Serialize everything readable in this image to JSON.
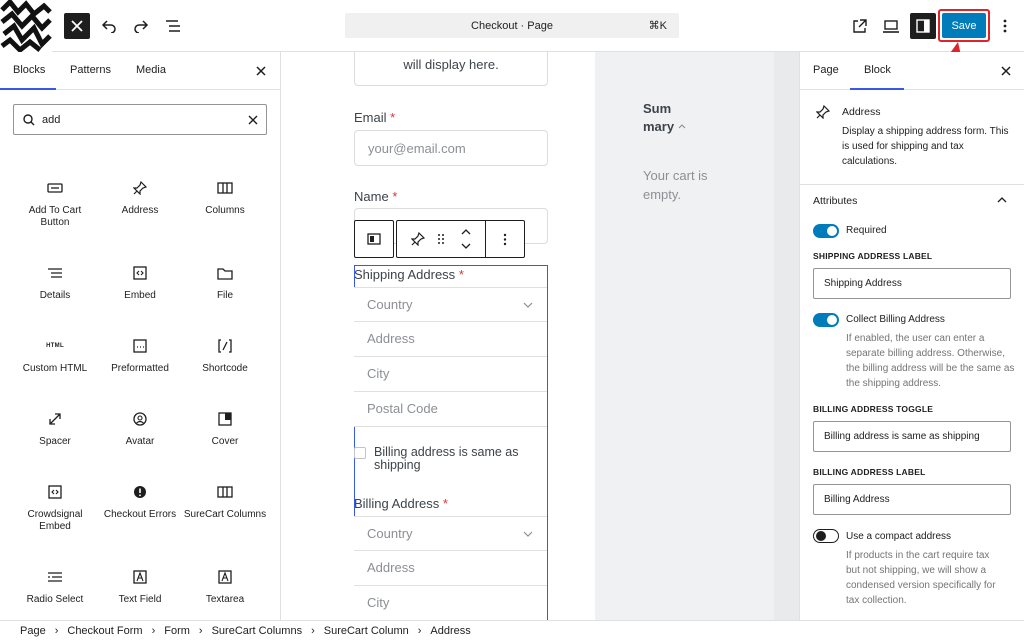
{
  "topbar": {
    "command_center": "Checkout · Page",
    "shortcut": "⌘K",
    "save_label": "Save",
    "icons": [
      "close-icon",
      "undo-icon",
      "redo-icon",
      "document-overview-icon",
      "external-view-icon",
      "device-preview-icon",
      "settings-panel-icon",
      "more-options-icon"
    ]
  },
  "inserter": {
    "tabs": [
      "Blocks",
      "Patterns",
      "Media"
    ],
    "search_value": "add",
    "blocks": [
      {
        "label": "Add To Cart Button",
        "icon": "button-icon"
      },
      {
        "label": "Address",
        "icon": "pin-icon"
      },
      {
        "label": "Columns",
        "icon": "columns-icon"
      },
      {
        "label": "Details",
        "icon": "details-icon"
      },
      {
        "label": "Embed",
        "icon": "embed-icon"
      },
      {
        "label": "File",
        "icon": "folder-icon"
      },
      {
        "label": "Custom HTML",
        "icon": "html-icon"
      },
      {
        "label": "Preformatted",
        "icon": "preformatted-icon"
      },
      {
        "label": "Shortcode",
        "icon": "shortcode-icon"
      },
      {
        "label": "Spacer",
        "icon": "spacer-icon"
      },
      {
        "label": "Avatar",
        "icon": "avatar-icon"
      },
      {
        "label": "Cover",
        "icon": "cover-icon"
      },
      {
        "label": "Crowdsignal Embed",
        "icon": "embed-icon"
      },
      {
        "label": "Checkout Errors",
        "icon": "error-icon"
      },
      {
        "label": "SureCart Columns",
        "icon": "columns-icon"
      },
      {
        "label": "Radio Select",
        "icon": "radio-select-icon"
      },
      {
        "label": "Text Field",
        "icon": "text-field-icon"
      },
      {
        "label": "Textarea",
        "icon": "textarea-icon"
      }
    ]
  },
  "canvas": {
    "placeholder_tail": "will display here.",
    "email_label": "Email",
    "email_placeholder": "your@email.com",
    "name_label": "Name",
    "shipping_label": "Shipping Address",
    "country": "Country",
    "address": "Address",
    "city": "City",
    "postal": "Postal Code",
    "billing_same": "Billing address is same as shipping",
    "billing_label": "Billing Address",
    "required_mark": "*",
    "summary_title": "Summary",
    "cart_empty": "Your cart is empty."
  },
  "settings": {
    "tabs": [
      "Page",
      "Block"
    ],
    "block_title": "Address",
    "block_desc": "Display a shipping address form. This is used for shipping and tax calculations.",
    "attributes_heading": "Attributes",
    "required_label": "Required",
    "shipping_label_heading": "SHIPPING ADDRESS LABEL",
    "shipping_label_value": "Shipping Address",
    "collect_billing_label": "Collect Billing Address",
    "collect_billing_help": "If enabled, the user can enter a separate billing address. Otherwise, the billing address will be the same as the shipping address.",
    "billing_toggle_heading": "BILLING ADDRESS TOGGLE",
    "billing_toggle_value": "Billing address is same as shipping",
    "billing_label_heading": "BILLING ADDRESS LABEL",
    "billing_label_value": "Billing Address",
    "compact_label": "Use a compact address",
    "compact_help": "If products in the cart require tax but not shipping, we will show a condensed version specifically for tax collection."
  },
  "breadcrumb": [
    "Page",
    "Checkout Form",
    "Form",
    "SureCart Columns",
    "SureCart Column",
    "Address"
  ]
}
